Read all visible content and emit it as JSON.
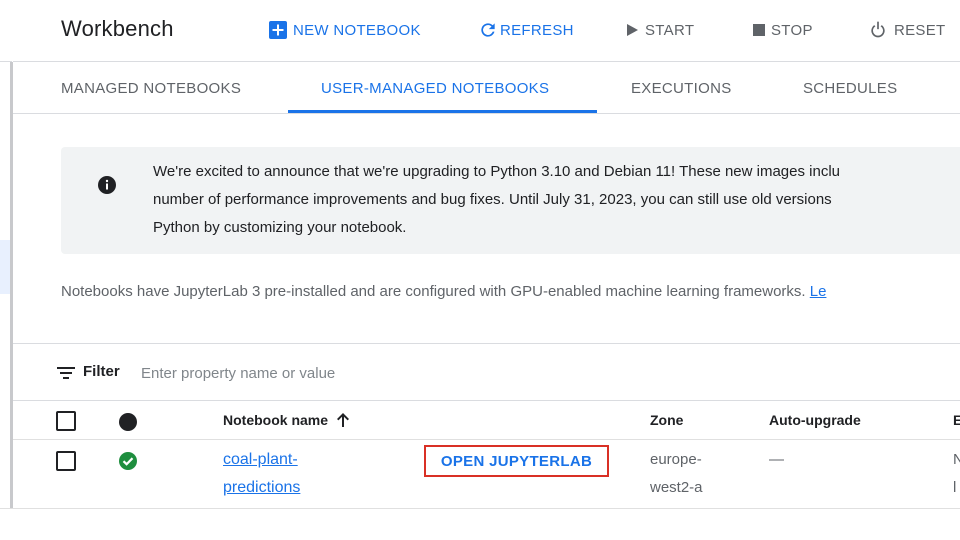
{
  "header": {
    "title": "Workbench",
    "buttons": {
      "new_notebook": "NEW NOTEBOOK",
      "refresh": "REFRESH",
      "start": "START",
      "stop": "STOP",
      "reset": "RESET"
    }
  },
  "tabs": [
    {
      "label": "MANAGED NOTEBOOKS"
    },
    {
      "label": "USER-MANAGED NOTEBOOKS"
    },
    {
      "label": "EXECUTIONS"
    },
    {
      "label": "SCHEDULES"
    }
  ],
  "active_tab": "USER-MANAGED NOTEBOOKS",
  "banner": {
    "lines": [
      "We're excited to announce that we're upgrading to Python 3.10 and Debian 11! These new images inclu",
      "number of performance improvements and bug fixes. Until July 31, 2023, you can still use old versions",
      "Python by customizing your notebook."
    ]
  },
  "description": {
    "text": "Notebooks have JupyterLab 3 pre-installed and are configured with GPU-enabled machine learning frameworks. ",
    "link": "Le"
  },
  "filter": {
    "label": "Filter",
    "placeholder": "Enter property name or value"
  },
  "table": {
    "columns": {
      "name": "Notebook name",
      "zone": "Zone",
      "auto_upgrade": "Auto-upgrade",
      "next": "E"
    },
    "rows": [
      {
        "name_line1": "coal-plant-",
        "name_line2": "predictions",
        "action": "OPEN JUPYTERLAB",
        "zone_line1": "europe-",
        "zone_line2": "west2-a",
        "auto_upgrade": "—",
        "next_line1": "N",
        "next_line2": "l"
      }
    ]
  },
  "colors": {
    "accent": "#1a73e8",
    "status_ok": "#1e8e3e",
    "highlight_box": "#d93025"
  }
}
